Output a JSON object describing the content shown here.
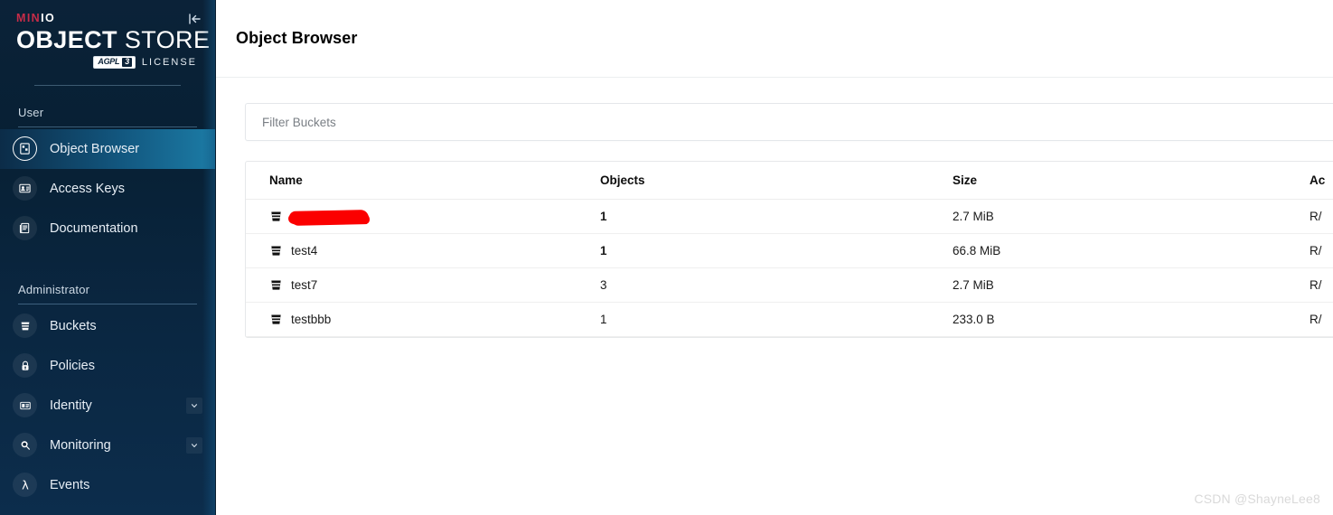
{
  "sidebar": {
    "brand": {
      "minio_prefix": "MIN",
      "minio_suffix": "IO",
      "object_word": "OBJECT",
      "store_word": "STORE",
      "agpl_label": "AGPL",
      "agpl_version": "3",
      "license_label": "LICENSE",
      "collapse_icon": "collapse-left-icon"
    },
    "sections": [
      {
        "title": "User",
        "items": [
          {
            "label": "Object Browser",
            "icon": "object-browser-icon",
            "active": true,
            "chevron": false
          },
          {
            "label": "Access Keys",
            "icon": "access-keys-icon",
            "active": false,
            "chevron": false
          },
          {
            "label": "Documentation",
            "icon": "documentation-icon",
            "active": false,
            "chevron": false
          }
        ]
      },
      {
        "title": "Administrator",
        "items": [
          {
            "label": "Buckets",
            "icon": "bucket-icon",
            "active": false,
            "chevron": false
          },
          {
            "label": "Policies",
            "icon": "lock-icon",
            "active": false,
            "chevron": false
          },
          {
            "label": "Identity",
            "icon": "identity-icon",
            "active": false,
            "chevron": true
          },
          {
            "label": "Monitoring",
            "icon": "monitoring-icon",
            "active": false,
            "chevron": true
          },
          {
            "label": "Events",
            "icon": "lambda-icon",
            "active": false,
            "chevron": false
          }
        ]
      }
    ]
  },
  "header": {
    "title": "Object Browser"
  },
  "filter": {
    "placeholder": "Filter Buckets",
    "value": ""
  },
  "table": {
    "columns": [
      {
        "key": "name",
        "label": "Name"
      },
      {
        "key": "objects",
        "label": "Objects"
      },
      {
        "key": "size",
        "label": "Size"
      },
      {
        "key": "access",
        "label": "Ac"
      }
    ],
    "rows": [
      {
        "name": "",
        "redacted": true,
        "objects": "1",
        "objects_bold": true,
        "size": "2.7 MiB",
        "access": "R/"
      },
      {
        "name": "test4",
        "redacted": false,
        "objects": "1",
        "objects_bold": true,
        "size": "66.8 MiB",
        "access": "R/"
      },
      {
        "name": "test7",
        "redacted": false,
        "objects": "3",
        "objects_bold": false,
        "size": "2.7 MiB",
        "access": "R/"
      },
      {
        "name": "testbbb",
        "redacted": false,
        "objects": "1",
        "objects_bold": false,
        "size": "233.0 B",
        "access": "R/"
      }
    ]
  },
  "watermark": {
    "text": "CSDN @ShayneLee8"
  },
  "colors": {
    "brand_red": "#C72C48",
    "sidebar_dark": "#0b2238",
    "active_accent": "#1c7ca6",
    "redaction": "#fb0000"
  }
}
